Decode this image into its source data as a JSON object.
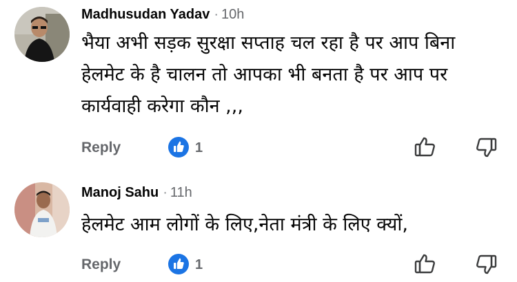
{
  "comments": [
    {
      "author": "Madhusudan Yadav",
      "separator": "·",
      "time": "10h",
      "text_lines": [
        "भैया अभी सड़क सुरक्षा सप्ताह चल रहा है पर आप बिना",
        "हेलमेट के है चालन तो आपका भी बनता है पर आप पर",
        "कार्यवाही करेगा कौन ,,,"
      ],
      "reply_label": "Reply",
      "like_count": "1",
      "avatar_icon": "user-photo-avatar"
    },
    {
      "author": "Manoj Sahu",
      "separator": "·",
      "time": "11h",
      "text_lines": [
        "हेलमेट आम लोगों के लिए,नेता मंत्री के लिए क्यों,"
      ],
      "reply_label": "Reply",
      "like_count": "1",
      "avatar_icon": "user-photo-avatar"
    }
  ],
  "colors": {
    "accent_like": "#1b74e4",
    "muted_text": "#65676b",
    "text": "#050505"
  }
}
